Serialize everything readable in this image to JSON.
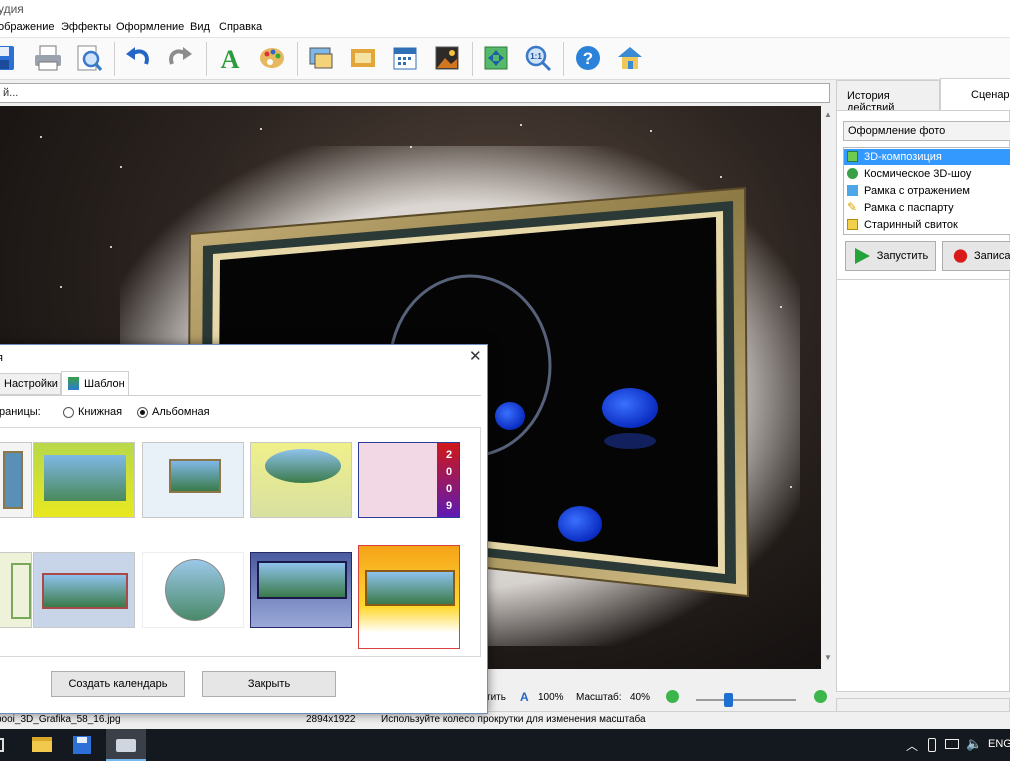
{
  "window": {
    "title": "удия"
  },
  "menu": [
    "ображение",
    "Эффекты",
    "Оформление",
    "Вид",
    "Справка"
  ],
  "toolbar": {
    "icons": [
      "save-icon",
      "print-icon",
      "print-preview-icon",
      "undo-icon",
      "redo-icon",
      "text-icon",
      "palette-icon",
      "image-insert-icon",
      "frame-icon",
      "calendar-icon",
      "picture-icon",
      "fit-icon",
      "actual-size-icon",
      "help-icon",
      "home-icon"
    ]
  },
  "address": {
    "value": "й..."
  },
  "right_panel": {
    "tabs": [
      "История действий",
      "Сценарии"
    ],
    "group_label": "Оформление фото",
    "items": [
      "3D-композиция",
      "Космическое 3D-шоу",
      "Рамка с отражением",
      "Рамка с паспарту",
      "Старинный свиток"
    ],
    "run_label": "Запустить",
    "record_label": "Записать"
  },
  "status": {
    "prefix": "тить",
    "text_zoom": "100%",
    "scale_label": "Масштаб:",
    "scale_value": "40%",
    "slider_level_percent": 28
  },
  "info": {
    "filename": "pooi_3D_Grafika_58_16.jpg",
    "dimensions": "2894x1922",
    "hint": "Используйте колесо прокрутки для изменения масштаба"
  },
  "dialog": {
    "title": "я",
    "tabs": [
      "Настройки",
      "Шаблон"
    ],
    "orientation_label": "раницы:",
    "orientation_options": [
      "Книжная",
      "Альбомная"
    ],
    "orientation_selected": "Альбомная",
    "create_label": "Создать календарь",
    "close_label": "Закрыть",
    "calendar_year_digits": [
      "2",
      "0",
      "0",
      "9"
    ]
  },
  "taskbar": {
    "lang": "ENG"
  }
}
